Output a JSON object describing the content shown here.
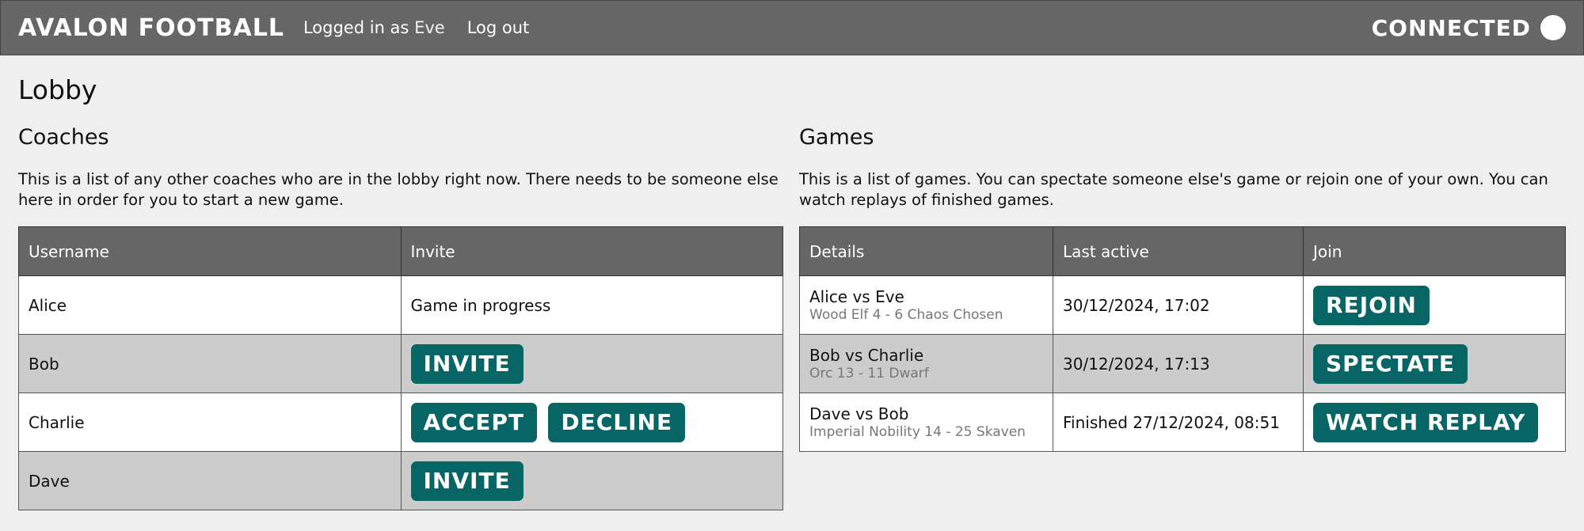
{
  "header": {
    "brand": "AVALON FOOTBALL",
    "logged_prefix": "Logged in as",
    "username": "Eve",
    "logout": "Log out",
    "status": "CONNECTED"
  },
  "page": {
    "title": "Lobby"
  },
  "coaches": {
    "title": "Coaches",
    "description": "This is a list of any other coaches who are in the lobby right now. There needs to be someone else here in order for you to start a new game.",
    "columns": [
      "Username",
      "Invite"
    ],
    "rows": [
      {
        "username": "Alice",
        "status_text": "Game in progress"
      },
      {
        "username": "Bob",
        "invite": "INVITE"
      },
      {
        "username": "Charlie",
        "accept": "ACCEPT",
        "decline": "DECLINE"
      },
      {
        "username": "Dave",
        "invite": "INVITE"
      }
    ]
  },
  "games": {
    "title": "Games",
    "description": "This is a list of games. You can spectate someone else's game or rejoin one of your own. You can watch replays of finished games.",
    "columns": [
      "Details",
      "Last active",
      "Join"
    ],
    "rows": [
      {
        "title": "Alice vs Eve",
        "sub": "Wood Elf 4 - 6 Chaos Chosen",
        "last_active": "30/12/2024, 17:02",
        "action": "REJOIN"
      },
      {
        "title": "Bob vs Charlie",
        "sub": "Orc 13 - 11 Dwarf",
        "last_active": "30/12/2024, 17:13",
        "action": "SPECTATE"
      },
      {
        "title": "Dave vs Bob",
        "sub": "Imperial Nobility 14 - 25 Skaven",
        "last_active": "Finished 27/12/2024, 08:51",
        "action": "WATCH REPLAY"
      }
    ]
  },
  "colors": {
    "header_bg": "#666666",
    "button_bg": "#076565",
    "page_bg": "#efefef",
    "row_alt": "#cccccc"
  }
}
